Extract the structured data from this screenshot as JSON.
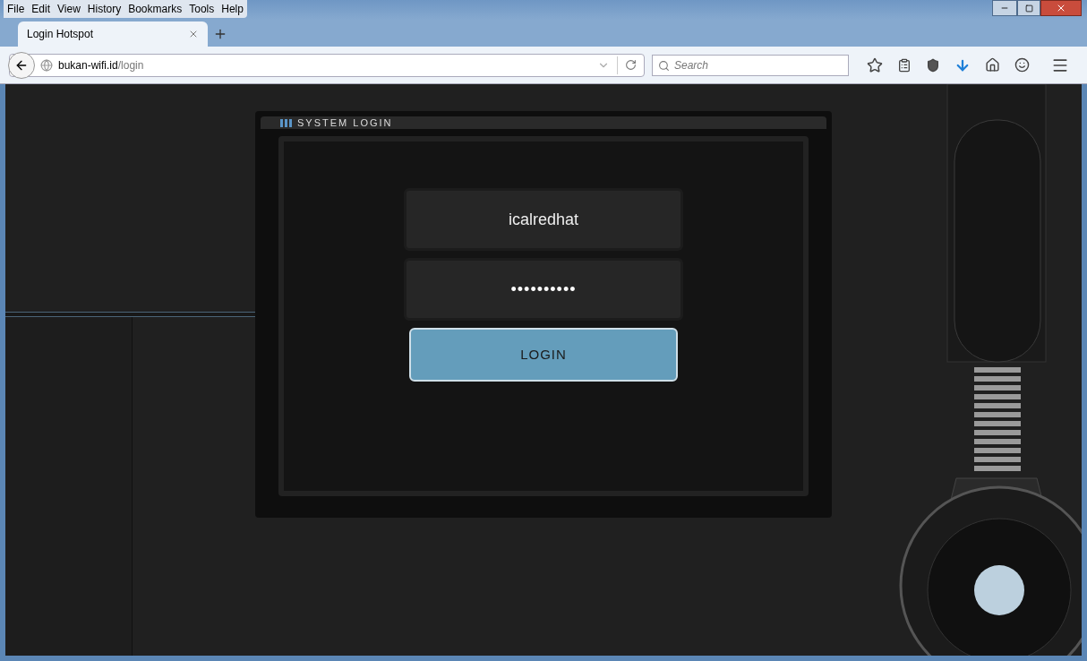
{
  "menu": [
    "File",
    "Edit",
    "View",
    "History",
    "Bookmarks",
    "Tools",
    "Help"
  ],
  "tabs": [
    {
      "label": "Login Hotspot",
      "selected": true
    }
  ],
  "address": {
    "host": "bukan-wifi.id",
    "path": "/login"
  },
  "search": {
    "placeholder": "Search"
  },
  "login_panel": {
    "title": "SYSTEM LOGIN",
    "username": "icalredhat",
    "password": "••••••••••",
    "button": "LOGIN"
  }
}
